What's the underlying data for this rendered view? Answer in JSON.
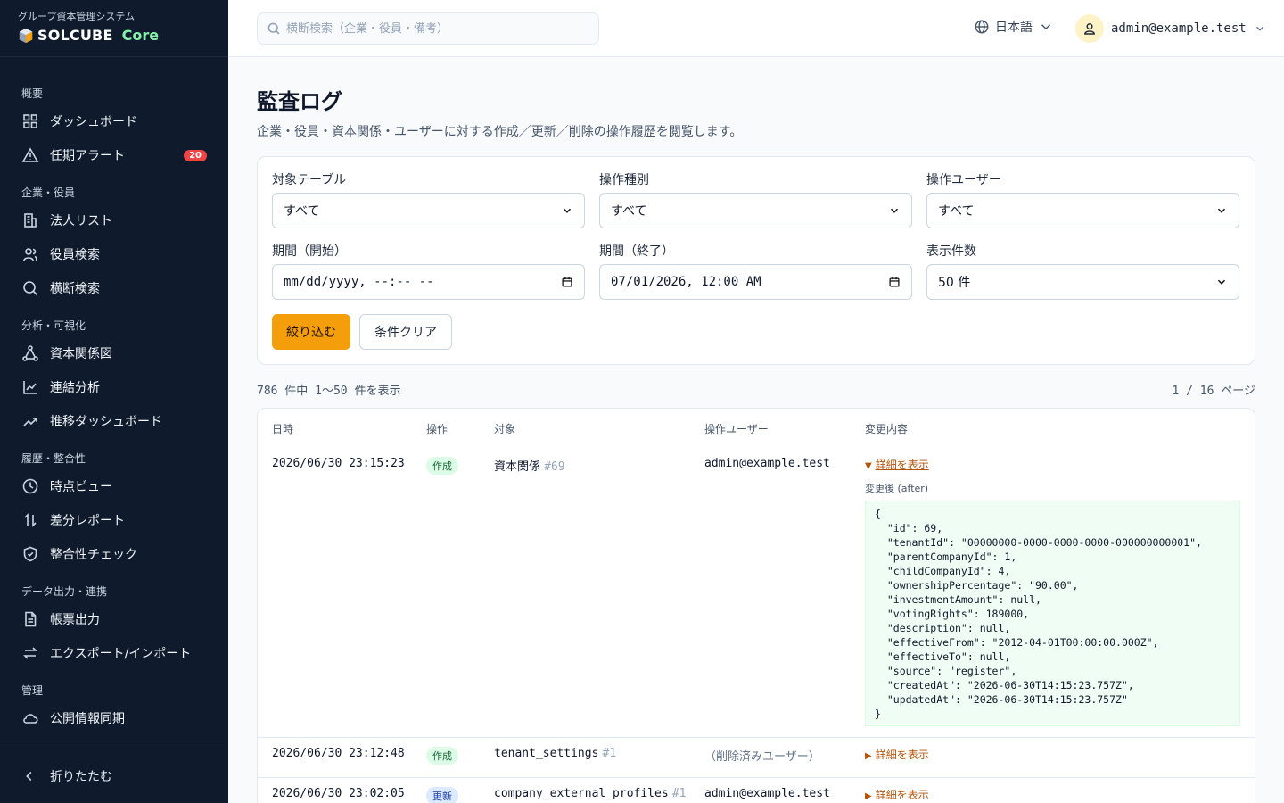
{
  "sidebar": {
    "brand_sub": "グループ資本管理システム",
    "brand_name": "SOLCUBE",
    "brand_accent": "Core",
    "sections": [
      {
        "title": "概要",
        "items": [
          {
            "label": "ダッシュボード",
            "icon": "grid-icon"
          },
          {
            "label": "任期アラート",
            "icon": "alert-icon",
            "badge": "20"
          }
        ]
      },
      {
        "title": "企業・役員",
        "items": [
          {
            "label": "法人リスト",
            "icon": "building-icon"
          },
          {
            "label": "役員検索",
            "icon": "users-icon"
          },
          {
            "label": "横断検索",
            "icon": "search-icon"
          }
        ]
      },
      {
        "title": "分析・可視化",
        "items": [
          {
            "label": "資本関係図",
            "icon": "network-icon"
          },
          {
            "label": "連結分析",
            "icon": "line-chart-icon"
          },
          {
            "label": "推移ダッシュボード",
            "icon": "trend-icon"
          }
        ]
      },
      {
        "title": "履歴・整合性",
        "items": [
          {
            "label": "時点ビュー",
            "icon": "clock-icon"
          },
          {
            "label": "差分レポート",
            "icon": "swap-vertical-icon"
          },
          {
            "label": "整合性チェック",
            "icon": "shield-icon"
          }
        ]
      },
      {
        "title": "データ出力・連携",
        "items": [
          {
            "label": "帳票出力",
            "icon": "document-icon"
          },
          {
            "label": "エクスポート/インポート",
            "icon": "swap-horizontal-icon"
          }
        ]
      },
      {
        "title": "管理",
        "items": [
          {
            "label": "公開情報同期",
            "icon": "cloud-icon"
          }
        ]
      }
    ],
    "collapse_label": "折りたたむ"
  },
  "header": {
    "search_placeholder": "横断検索（企業・役員・備考）",
    "language": "日本語",
    "user_email": "admin@example.test"
  },
  "page": {
    "title": "監査ログ",
    "description": "企業・役員・資本関係・ユーザーに対する作成／更新／削除の操作履歴を閲覧します。"
  },
  "filters": {
    "table_label": "対象テーブル",
    "table_value": "すべて",
    "action_label": "操作種別",
    "action_value": "すべて",
    "user_label": "操作ユーザー",
    "user_value": "すべて",
    "from_label": "期間（開始）",
    "from_value": "mm/dd/yyyy, --:-- --",
    "to_label": "期間（終了）",
    "to_value": "07/01/2026, 12:00 AM",
    "limit_label": "表示件数",
    "limit_value": "50 件",
    "apply_label": "絞り込む",
    "clear_label": "条件クリア"
  },
  "summary": {
    "count_text": "786 件中 1〜50 件を表示",
    "page_text": "1 / 16 ページ"
  },
  "table": {
    "headers": [
      "日時",
      "操作",
      "対象",
      "操作ユーザー",
      "変更内容"
    ],
    "rows": [
      {
        "datetime": "2026/06/30 23:15:23",
        "action": "作成",
        "action_type": "create",
        "target": "資本関係",
        "target_id": "#69",
        "user": "admin@example.test",
        "details_label": "詳細を表示",
        "expanded": true,
        "after_label": "変更後 (after)",
        "after_json": "{\n  \"id\": 69,\n  \"tenantId\": \"00000000-0000-0000-0000-000000000001\",\n  \"parentCompanyId\": 1,\n  \"childCompanyId\": 4,\n  \"ownershipPercentage\": \"90.00\",\n  \"investmentAmount\": null,\n  \"votingRights\": 189000,\n  \"description\": null,\n  \"effectiveFrom\": \"2012-04-01T00:00:00.000Z\",\n  \"effectiveTo\": null,\n  \"source\": \"register\",\n  \"createdAt\": \"2026-06-30T14:15:23.757Z\",\n  \"updatedAt\": \"2026-06-30T14:15:23.757Z\"\n}"
      },
      {
        "datetime": "2026/06/30 23:12:48",
        "action": "作成",
        "action_type": "create",
        "target": "tenant_settings",
        "target_id": "#1",
        "user": "（削除済みユーザー）",
        "details_label": "詳細を表示",
        "expanded": false
      },
      {
        "datetime": "2026/06/30 23:02:05",
        "action": "更新",
        "action_type": "update",
        "target": "company_external_profiles",
        "target_id": "#1",
        "user": "admin@example.test",
        "details_label": "詳細を表示",
        "expanded": false
      }
    ]
  },
  "colors": {
    "sidebar_bg": "#0f1b2d",
    "accent": "#f59e0b",
    "badge": "#ef4444",
    "link": "#b45309"
  }
}
